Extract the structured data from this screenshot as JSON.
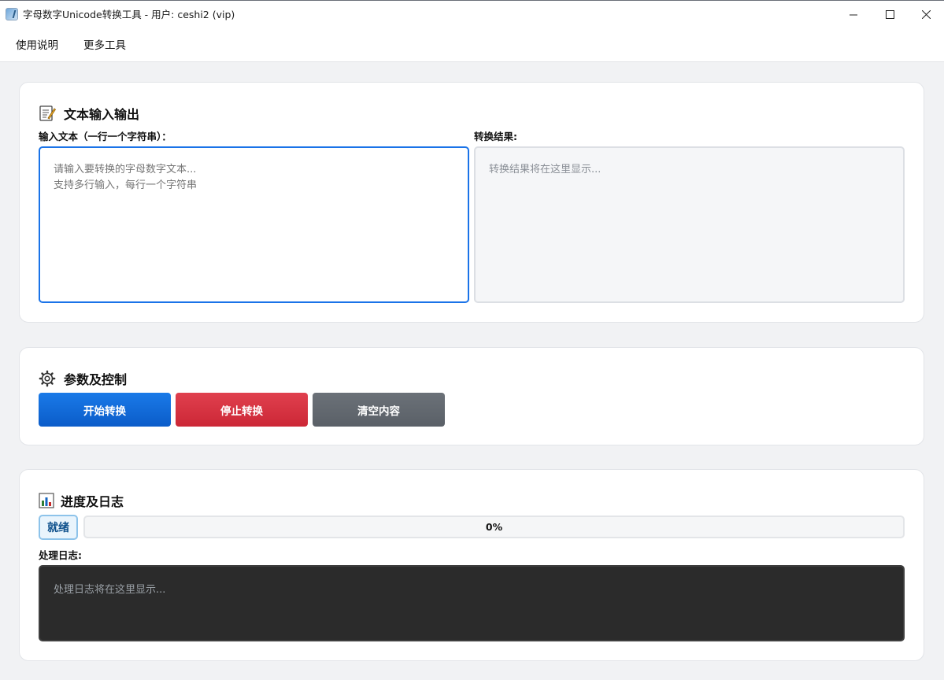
{
  "window": {
    "title": "字母数字Unicode转换工具 - 用户: ceshi2 (vip)",
    "minimize_glyph": "—",
    "maximize_glyph": "☐",
    "close_glyph": "✕"
  },
  "menu": {
    "items": [
      {
        "label": "使用说明"
      },
      {
        "label": "更多工具"
      }
    ]
  },
  "io_section": {
    "title": "文本输入输出",
    "icon": "memo-icon",
    "input_label": "输入文本（一行一个字符串）：",
    "input_placeholder": "请输入要转换的字母数字文本...\n支持多行输入，每行一个字符串",
    "input_value": "",
    "output_label": "转换结果:",
    "output_placeholder": "转换结果将在这里显示..."
  },
  "control_section": {
    "title": "参数及控制",
    "icon": "gear-icon",
    "start_label": "开始转换",
    "stop_label": "停止转换",
    "clear_label": "清空内容"
  },
  "progress_section": {
    "title": "进度及日志",
    "icon": "bar-chart-icon",
    "status": "就绪",
    "progress_percent": 0,
    "progress_text": "0%",
    "log_label": "处理日志:",
    "log_placeholder": "处理日志将在这里显示..."
  },
  "colors": {
    "accent": "#1a73e8",
    "start_button": "#0b5cc9",
    "stop_button": "#cc2736",
    "clear_button": "#5a6067",
    "log_background": "#2b2b2b"
  }
}
